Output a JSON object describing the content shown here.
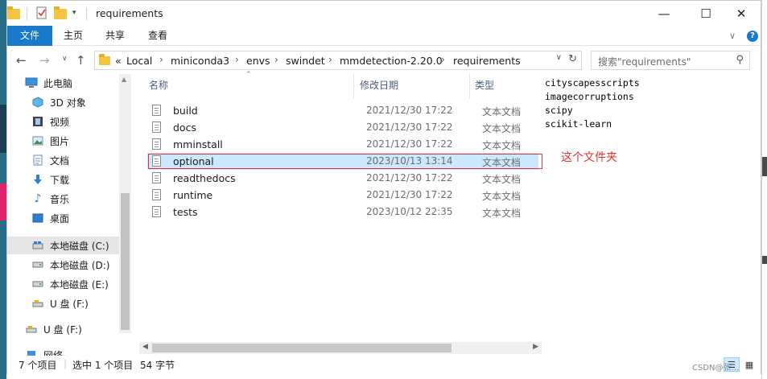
{
  "window": {
    "title": "requirements",
    "controls": {
      "minimize": "—",
      "maximize": "☐",
      "close": "✕"
    }
  },
  "ribbon": {
    "tabs": [
      "文件",
      "主页",
      "共享",
      "查看"
    ],
    "expand": "∨",
    "help": "?"
  },
  "addressbar": {
    "overflow": "«",
    "path": [
      "Local",
      "miniconda3",
      "envs",
      "swindet",
      "mmdetection-2.20.0",
      "requirements"
    ],
    "search_placeholder": "搜索\"requirements\""
  },
  "sidebar": {
    "items": [
      {
        "label": "此电脑",
        "icon": "computer-icon"
      },
      {
        "label": "3D 对象",
        "icon": "3d-objects-icon"
      },
      {
        "label": "视频",
        "icon": "video-icon"
      },
      {
        "label": "图片",
        "icon": "pictures-icon"
      },
      {
        "label": "文档",
        "icon": "documents-icon"
      },
      {
        "label": "下载",
        "icon": "download-icon"
      },
      {
        "label": "音乐",
        "icon": "music-icon"
      },
      {
        "label": "桌面",
        "icon": "desktop-icon"
      },
      {
        "label": "本地磁盘 (C:)",
        "icon": "drive-icon"
      },
      {
        "label": "本地磁盘 (D:)",
        "icon": "drive-icon"
      },
      {
        "label": "本地磁盘 (E:)",
        "icon": "drive-icon"
      },
      {
        "label": "U 盘 (F:)",
        "icon": "usb-drive-icon"
      },
      {
        "label": "U 盘 (F:)",
        "icon": "usb-drive-icon"
      },
      {
        "label": "网络",
        "icon": "network-icon"
      }
    ]
  },
  "filelist": {
    "columns": [
      "名称",
      "修改日期",
      "类型"
    ],
    "rows": [
      {
        "name": "build",
        "date": "2021/12/30 17:22",
        "type": "文本文档"
      },
      {
        "name": "docs",
        "date": "2021/12/30 17:22",
        "type": "文本文档"
      },
      {
        "name": "mminstall",
        "date": "2021/12/30 17:22",
        "type": "文本文档"
      },
      {
        "name": "optional",
        "date": "2023/10/13 13:14",
        "type": "文本文档"
      },
      {
        "name": "readthedocs",
        "date": "2021/12/30 17:22",
        "type": "文本文档"
      },
      {
        "name": "runtime",
        "date": "2021/12/30 17:22",
        "type": "文本文档"
      },
      {
        "name": "tests",
        "date": "2023/10/12 22:35",
        "type": "文本文档"
      }
    ],
    "selected_index": 3
  },
  "annotation": {
    "note": "这个文件夹",
    "color": "#e0332e",
    "content_lines": [
      "cityscapesscripts",
      "imagecorruptions",
      "scipy",
      "scikit-learn"
    ]
  },
  "statusbar": {
    "count": "7 个项目",
    "selection": "选中 1 个项目",
    "size": "54 字节"
  },
  "watermark": "CSDN@张…"
}
